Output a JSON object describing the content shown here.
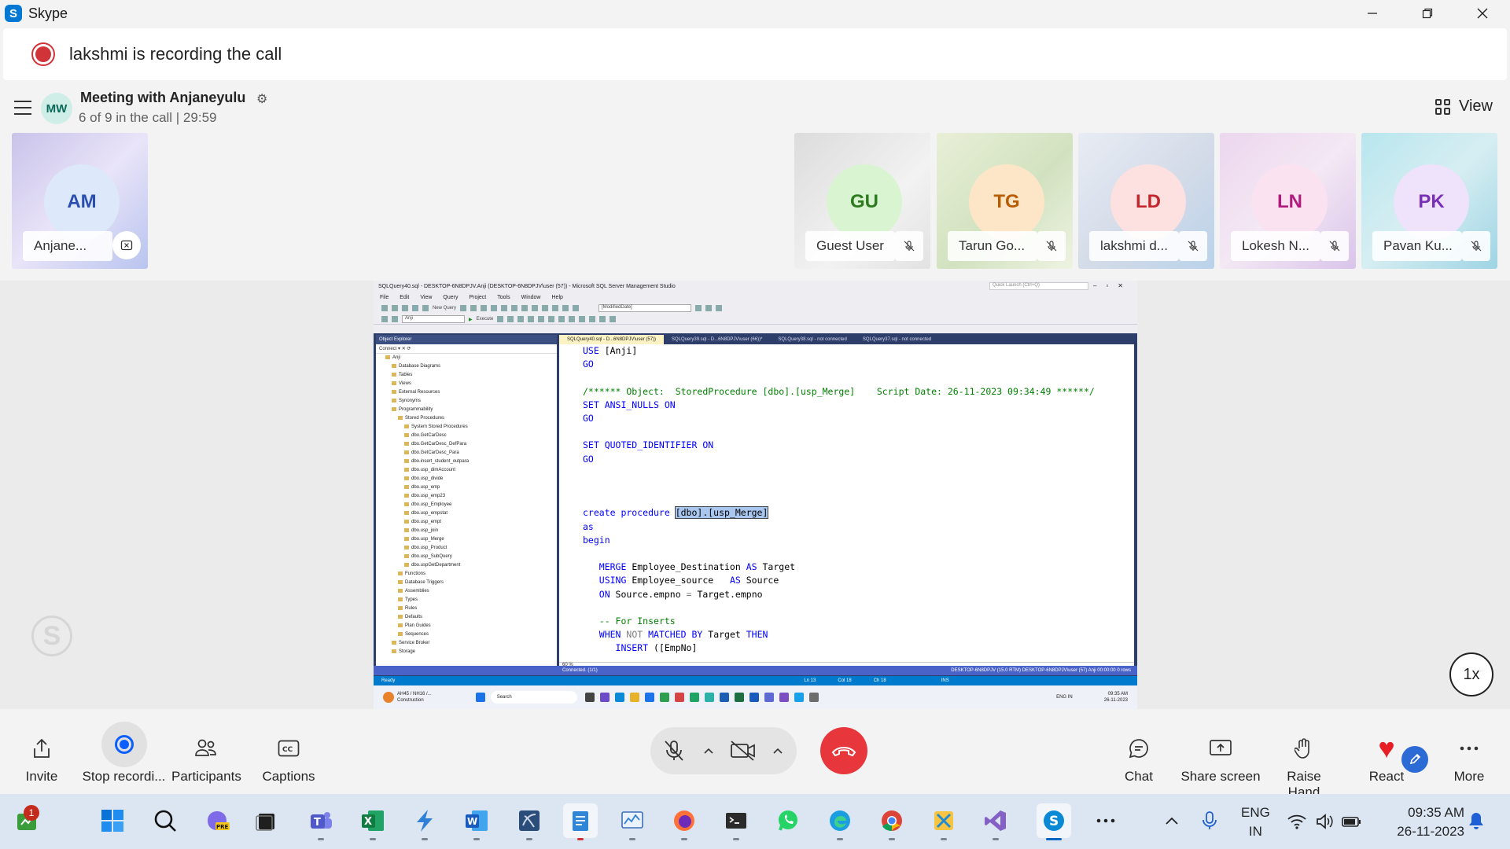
{
  "window": {
    "app_name": "Skype"
  },
  "banner": {
    "text": "lakshmi is recording the call"
  },
  "meeting": {
    "avatar_initials": "MW",
    "title": "Meeting with Anjaneyulu",
    "subtitle": "6 of 9 in the call | 29:59",
    "view_label": "View"
  },
  "participants": [
    {
      "initials": "AM",
      "name": "Anjane...",
      "avatar_bg": "#dde8fb",
      "avatar_fg": "#2b4fb0"
    },
    {
      "initials": "GU",
      "name": "Guest User",
      "avatar_bg": "#d8f4d0",
      "avatar_fg": "#2d7a1f"
    },
    {
      "initials": "TG",
      "name": "Tarun Go...",
      "avatar_bg": "#fde6c8",
      "avatar_fg": "#b85c00"
    },
    {
      "initials": "LD",
      "name": "lakshmi d...",
      "avatar_bg": "#fde0e0",
      "avatar_fg": "#c4262e"
    },
    {
      "initials": "LN",
      "name": "Lokesh N...",
      "avatar_bg": "#fbe2f1",
      "avatar_fg": "#b0197e"
    },
    {
      "initials": "PK",
      "name": "Pavan Ku...",
      "avatar_bg": "#efe2fb",
      "avatar_fg": "#7a2fb8"
    }
  ],
  "shared_screen": {
    "title": "SQLQuery40.sql - DESKTOP-6N8DPJV.Anji (DESKTOP-6N8DPJV\\user (57)) - Microsoft SQL Server Management Studio",
    "quick_launch": "Quick Launch (Ctrl+Q)",
    "menu": [
      "File",
      "Edit",
      "View",
      "Query",
      "Project",
      "Tools",
      "Window",
      "Help"
    ],
    "toolbar": {
      "new_query": "New Query",
      "db_combo": "Anji",
      "execute": "Execute",
      "param_combo": "[ModifiedDate]"
    },
    "object_explorer": {
      "header": "Object Explorer",
      "connect": "Connect",
      "tree": [
        "Anji",
        "Database Diagrams",
        "Tables",
        "Views",
        "External Resources",
        "Synonyms",
        "Programmability",
        "Stored Procedures",
        "System Stored Procedures",
        "dbo.GetCarDesc",
        "dbo.GetCarDesc_DefPara",
        "dbo.GetCarDesc_Para",
        "dbo.insert_student_outpara",
        "dbo.usp_dimAccount",
        "dbo.usp_divide",
        "dbo.usp_emp",
        "dbo.usp_emp23",
        "dbo.usp_Employee",
        "dbo.usp_empstat",
        "dbo.usp_empt",
        "dbo.usp_join",
        "dbo.usp_Merge",
        "dbo.usp_Product",
        "dbo.usp_SubQuery",
        "dbo.uspGetDepartment",
        "Functions",
        "Database Triggers",
        "Assemblies",
        "Types",
        "Rules",
        "Defaults",
        "Plan Guides",
        "Sequences",
        "Service Broker",
        "Storage"
      ]
    },
    "tabs": [
      {
        "label": "SQLQuery40.sql - D...6N8DPJV\\user (57))",
        "active": true
      },
      {
        "label": "SQLQuery39.sql - D...6N8DPJV\\user (66))*",
        "active": false
      },
      {
        "label": "SQLQuery38.sql - not connected",
        "active": false
      },
      {
        "label": "SQLQuery37.sql - not connected",
        "active": false
      }
    ],
    "zoom": "60 %",
    "status_connected": "Connected. (1/1)",
    "status_right": "DESKTOP-6N8DPJV (15.0 RTM)   DESKTOP-6N8DPJV\\user (57)   Anji   00:00:00   0 rows",
    "status_pos": {
      "ln": "Ln 13",
      "col": "Col 18",
      "ch": "Ch 18",
      "ins": "INS"
    },
    "ready": "Ready",
    "taskbar": {
      "weather": "AH45 / NH16 /...",
      "weather_sub": "Construction",
      "search": "Search",
      "lang": "ENG IN",
      "time": "09:35 AM",
      "date": "26-11-2023"
    }
  },
  "speed": "1x",
  "controls": {
    "invite": "Invite",
    "stop_recording": "Stop recordi...",
    "participants": "Participants",
    "captions": "Captions",
    "chat": "Chat",
    "share_screen": "Share screen",
    "raise_hand": "Raise Hand",
    "react": "React",
    "more": "More"
  },
  "taskbar": {
    "notification_count": "1",
    "lang_top": "ENG",
    "lang_bottom": "IN",
    "time": "09:35 AM",
    "date": "26-11-2023"
  },
  "colors": {
    "accent": "#0b5fff",
    "end_call": "#e8363d",
    "recording": "#d13438",
    "taskbar": "#dbe6f2"
  }
}
